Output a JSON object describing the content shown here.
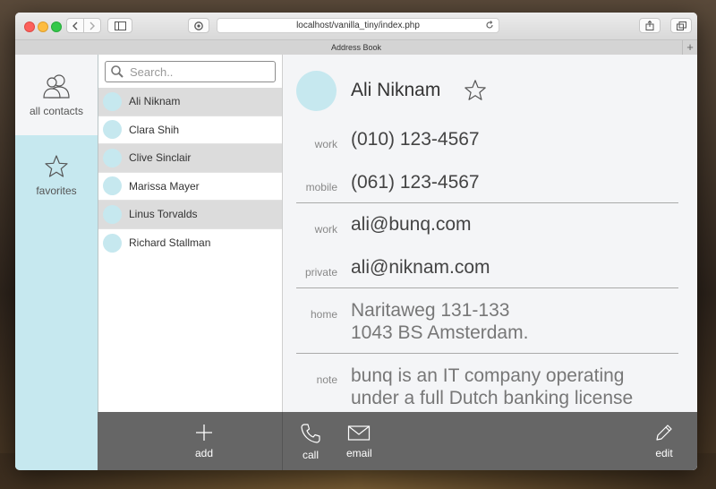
{
  "browser": {
    "url": "localhost/vanilla_tiny/index.php",
    "tab_title": "Address Book"
  },
  "sidebar": {
    "items": [
      {
        "label": "all contacts",
        "icon": "people-icon"
      },
      {
        "label": "favorites",
        "icon": "star-icon"
      }
    ]
  },
  "search": {
    "placeholder": "Search.."
  },
  "contacts": [
    {
      "name": "Ali Niknam"
    },
    {
      "name": "Clara Shih"
    },
    {
      "name": "Clive Sinclair"
    },
    {
      "name": "Marissa Mayer"
    },
    {
      "name": "Linus Torvalds"
    },
    {
      "name": "Richard Stallman"
    }
  ],
  "detail": {
    "name": "Ali Niknam",
    "phones": [
      {
        "label": "work",
        "value": "(010) 123-4567"
      },
      {
        "label": "mobile",
        "value": "(061) 123-4567"
      }
    ],
    "emails": [
      {
        "label": "work",
        "value": "ali@bunq.com"
      },
      {
        "label": "private",
        "value": "ali@niknam.com"
      }
    ],
    "address": {
      "label": "home",
      "line1": "Naritaweg 131-133",
      "line2": "1043 BS Amsterdam."
    },
    "note": {
      "label": "note",
      "line1": "bunq is an IT company operating",
      "line2": "under a full Dutch banking license"
    }
  },
  "toolbar": {
    "add_label": "add",
    "call_label": "call",
    "email_label": "email",
    "edit_label": "edit"
  },
  "colors": {
    "accent": "#c6e8ef",
    "toolbar": "#666666"
  }
}
